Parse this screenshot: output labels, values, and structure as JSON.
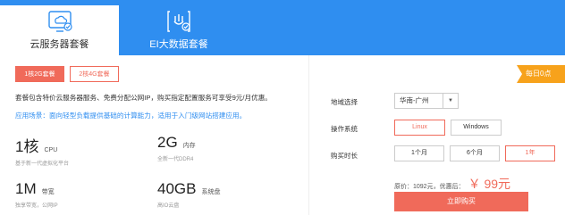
{
  "tabs": [
    {
      "label": "云服务器套餐",
      "icon": "cloud-server-icon",
      "active": true
    },
    {
      "label": "EI大数据套餐",
      "icon": "ei-data-icon",
      "active": false
    }
  ],
  "configs": [
    {
      "label": "1核2G套餐",
      "selected": true
    },
    {
      "label": "2核4G套餐",
      "selected": false
    }
  ],
  "description": "套餐包含特价云服务器服务、免费分配公网IP，购买指定配置服务可享受9元/月优惠。",
  "scenario": "应用场景：面向轻型负载提供基础的计算能力，适用于入门级网站搭建应用。",
  "specs": [
    {
      "value": "1核",
      "unit": "CPU",
      "sub": "基于新一代虚拟化平台"
    },
    {
      "value": "2G",
      "unit": "内存",
      "sub": "全新一代DDR4"
    },
    {
      "value": "1M",
      "unit": "带宽",
      "sub": "独享带宽，公网IP"
    },
    {
      "value": "40GB",
      "unit": "系统盘",
      "sub": "高IO云盘"
    }
  ],
  "form": {
    "region_label": "地域选择",
    "region_value": "华南-广州",
    "os_label": "操作系统",
    "os_options": [
      "Linux",
      "Windows"
    ],
    "os_selected": 0,
    "duration_label": "购买时长",
    "duration_options": [
      "1个月",
      "6个月",
      "1年"
    ],
    "duration_selected": 2,
    "original_price_label": "原价：",
    "original_price": "1092元，",
    "discount_label": "优惠后：",
    "discount_price": "￥ 99元",
    "buy_label": "立即购买"
  },
  "banner": "每日0点",
  "colors": {
    "primary": "#2f8ef0",
    "accent": "#f06a5a",
    "banner": "#f7a21b"
  }
}
